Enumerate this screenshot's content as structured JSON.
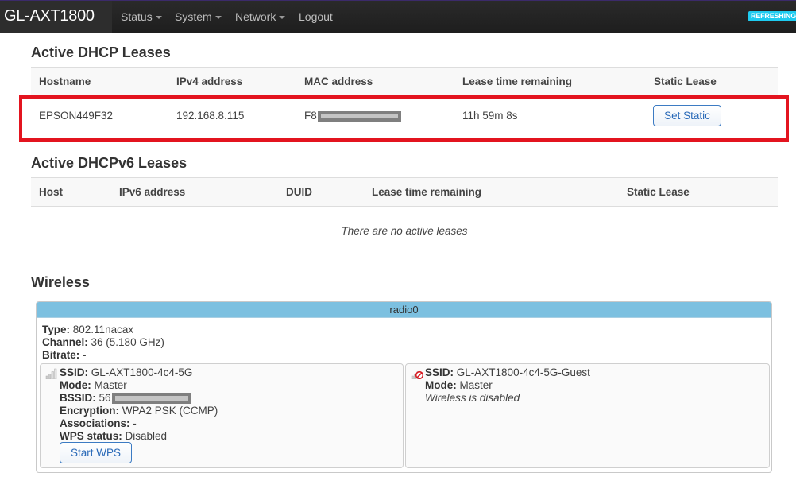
{
  "navbar": {
    "brand": "GL-AXT1800",
    "menu": [
      {
        "label": "Status",
        "dropdown": true
      },
      {
        "label": "System",
        "dropdown": true
      },
      {
        "label": "Network",
        "dropdown": true
      },
      {
        "label": "Logout",
        "dropdown": false
      }
    ],
    "refresh_badge": "REFRESHING"
  },
  "dhcp": {
    "title": "Active DHCP Leases",
    "columns": [
      "Hostname",
      "IPv4 address",
      "MAC address",
      "Lease time remaining",
      "Static Lease"
    ],
    "rows": [
      {
        "hostname": "EPSON449F32",
        "ipv4": "192.168.8.115",
        "mac_visible_prefix": "F8",
        "mac_redacted": true,
        "lease_remaining": "11h 59m 8s",
        "action_label": "Set Static"
      }
    ],
    "highlight_color": "#e3141f"
  },
  "dhcpv6": {
    "title": "Active DHCPv6 Leases",
    "columns": [
      "Host",
      "IPv6 address",
      "DUID",
      "Lease time remaining",
      "Static Lease"
    ],
    "empty_message": "There are no active leases"
  },
  "wireless": {
    "title": "Wireless",
    "radio": {
      "name": "radio0",
      "type_label": "Type:",
      "type": "802.11nacax",
      "channel_label": "Channel:",
      "channel": "36 (5.180 GHz)",
      "bitrate_label": "Bitrate:",
      "bitrate": "-"
    },
    "networks": [
      {
        "icon": "signal-bars-icon",
        "ssid_label": "SSID:",
        "ssid": "GL-AXT1800-4c4-5G",
        "mode_label": "Mode:",
        "mode": "Master",
        "bssid_label": "BSSID:",
        "bssid_visible_prefix": "56",
        "bssid_redacted": true,
        "encryption_label": "Encryption:",
        "encryption": "WPA2 PSK (CCMP)",
        "associations_label": "Associations:",
        "associations": "-",
        "wps_label": "WPS status:",
        "wps": "Disabled",
        "button_label": "Start WPS"
      },
      {
        "icon": "signal-disabled-icon",
        "ssid_label": "SSID:",
        "ssid": "GL-AXT1800-4c4-5G-Guest",
        "mode_label": "Mode:",
        "mode": "Master",
        "status": "Wireless is disabled"
      }
    ],
    "header_color": "#7cc0e0"
  }
}
